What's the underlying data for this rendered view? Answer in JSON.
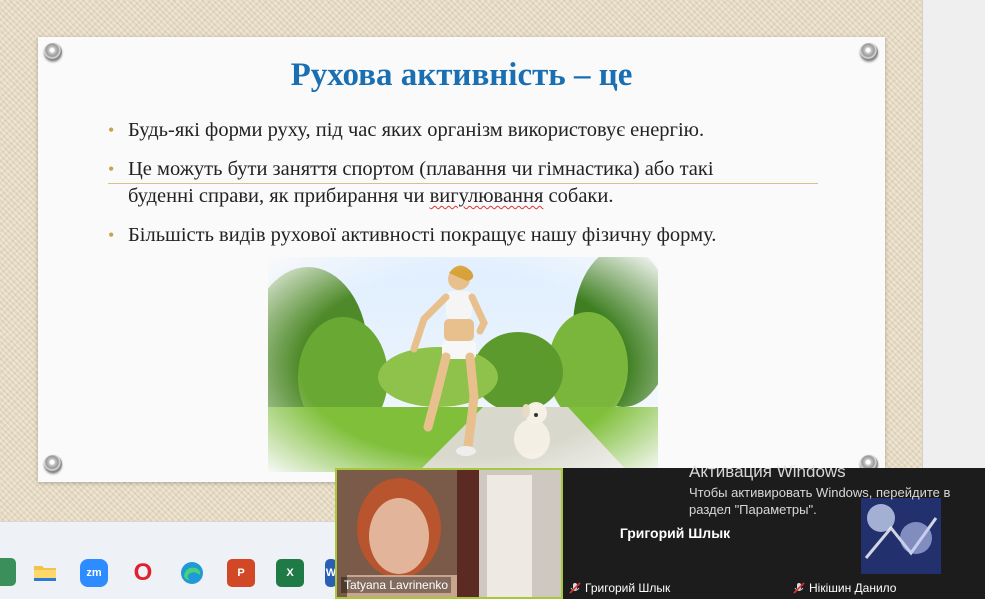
{
  "slide": {
    "title": "Рухова активність – це",
    "bullets": [
      {
        "text": "Будь-які форми руху, під час яких організм використовує енергію."
      },
      {
        "line1": "Це можуть бути заняття спортом (плавання чи гімнастика) або такі",
        "line2_a": "буденні справи, як прибирання чи ",
        "line2_b": "вигулювання",
        "line2_c": " собаки."
      },
      {
        "text": "Більшість видів рухової активності покращує нашу фізичну форму."
      }
    ],
    "bullet_color": "#c9a24e",
    "title_color": "#1a6fb3"
  },
  "video": {
    "tiles": [
      {
        "name": "Tatyana Lavrinenko",
        "muted": false
      },
      {
        "name": "Григорий Шлык",
        "center_label": "Григорий Шлык",
        "muted": true
      },
      {
        "name": "Нікішин Данило",
        "muted": true
      }
    ]
  },
  "activation": {
    "title": "Активация Windows",
    "line1": "Чтобы активировать Windows, перейдите в",
    "line2": "раздел \"Параметры\"."
  },
  "taskbar": {
    "icons": [
      {
        "name": "file-explorer-icon"
      },
      {
        "name": "zoom-icon",
        "label": "zm"
      },
      {
        "name": "opera-icon",
        "label": "O"
      },
      {
        "name": "edge-icon"
      },
      {
        "name": "powerpoint-icon",
        "label": "P"
      },
      {
        "name": "excel-icon",
        "label": "X"
      },
      {
        "name": "word-icon",
        "label": "W"
      }
    ]
  }
}
